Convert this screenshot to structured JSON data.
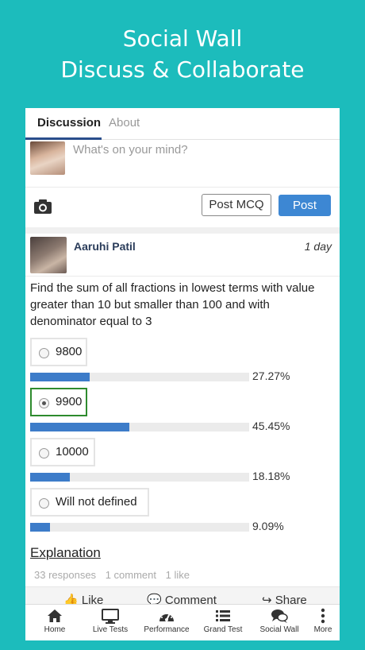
{
  "banner": {
    "line1": "Social Wall",
    "line2": "Discuss & Collaborate"
  },
  "tabs": [
    {
      "label": "Discussion"
    },
    {
      "label": "About"
    }
  ],
  "composer": {
    "placeholder": "What's on your mind?",
    "post_mcq": "Post MCQ",
    "post": "Post"
  },
  "post": {
    "author": "Aaruhi Patil",
    "time": "1 day",
    "question": "Find the sum of all fractions in lowest terms with value greater than 10 but smaller than 100 and with denominator equal to 3",
    "options": [
      {
        "label": "9800",
        "percent_text": "27.27%",
        "fraction": 0.2727,
        "selected": false
      },
      {
        "label": "9900",
        "percent_text": "45.45%",
        "fraction": 0.4545,
        "selected": true
      },
      {
        "label": "10000",
        "percent_text": "18.18%",
        "fraction": 0.1818,
        "selected": false
      },
      {
        "label": "Will not defined",
        "percent_text": "9.09%",
        "fraction": 0.0909,
        "selected": false
      }
    ],
    "explanation": "Explanation",
    "stats": {
      "responses": "33 responses",
      "comments": "1 comment",
      "likes": "1 like"
    },
    "actions": {
      "like": "Like",
      "comment": "Comment",
      "share": "Share"
    }
  },
  "bottom_nav": [
    {
      "label": "Home",
      "icon": "home-icon"
    },
    {
      "label": "Live Tests",
      "icon": "monitor-icon"
    },
    {
      "label": "Performance",
      "icon": "speedometer-icon"
    },
    {
      "label": "Grand Test",
      "icon": "list-icon"
    },
    {
      "label": "Social Wall",
      "icon": "chat-icon"
    },
    {
      "label": "More",
      "icon": "more-vertical-icon"
    }
  ],
  "colors": {
    "background": "#1cbcbc",
    "accent": "#3d87d3",
    "selected_border": "#2e8b2e"
  }
}
